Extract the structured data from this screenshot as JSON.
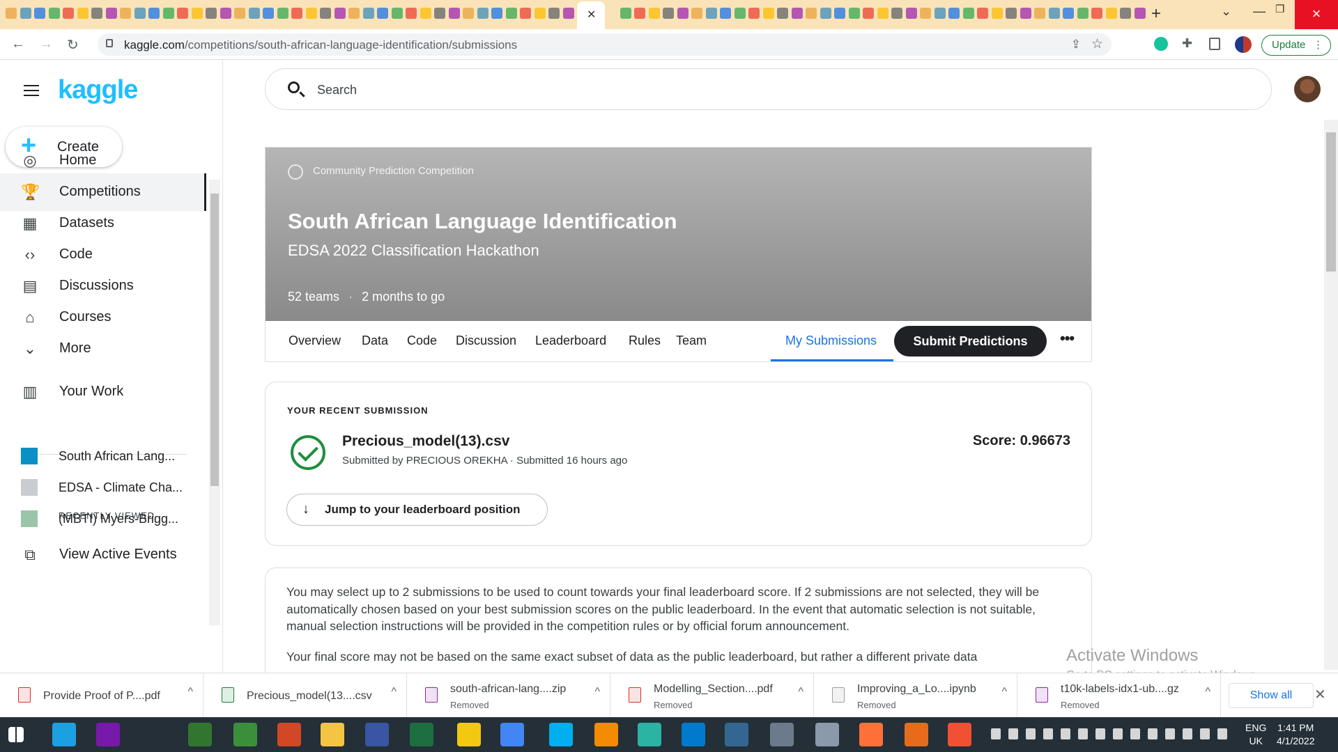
{
  "browser": {
    "url_host": "kaggle.com",
    "url_path": "/competitions/south-african-language-identification/submissions",
    "update_label": "Update",
    "tab_close_glyph": "✕",
    "newtab_glyph": "+"
  },
  "sidebar": {
    "logo": "kaggle",
    "create_label": "Create",
    "items": [
      {
        "label": "Home",
        "icon": "compass-icon",
        "glyph": "◎"
      },
      {
        "label": "Competitions",
        "icon": "trophy-icon",
        "glyph": "🏆"
      },
      {
        "label": "Datasets",
        "icon": "table-icon",
        "glyph": "▦"
      },
      {
        "label": "Code",
        "icon": "code-icon",
        "glyph": "‹›"
      },
      {
        "label": "Discussions",
        "icon": "discussion-icon",
        "glyph": "▤"
      },
      {
        "label": "Courses",
        "icon": "graduation-cap-icon",
        "glyph": "⌂"
      },
      {
        "label": "More",
        "icon": "chevron-down-icon",
        "glyph": "⌄"
      },
      {
        "label": "Your Work",
        "icon": "clipboard-icon",
        "glyph": "▥"
      }
    ],
    "recently_viewed_label": "RECENTLY VIEWED",
    "recent": [
      {
        "label": "South African Lang...",
        "color": "#0a8fc7"
      },
      {
        "label": "EDSA - Climate Cha...",
        "color": "#c9ccd1"
      },
      {
        "label": "(MBTI) Myers-Brigg...",
        "color": "#9bc5a8"
      }
    ],
    "view_events_label": "View Active Events"
  },
  "search": {
    "placeholder": "Search"
  },
  "competition": {
    "type": "Community Prediction Competition",
    "title": "South African Language Identification",
    "subtitle": "EDSA 2022 Classification Hackathon",
    "teams": "52 teams",
    "deadline": "2 months to go",
    "tabs": [
      "Overview",
      "Data",
      "Code",
      "Discussion",
      "Leaderboard",
      "Rules",
      "Team"
    ],
    "my_submissions": "My Submissions",
    "submit_label": "Submit Predictions",
    "more_glyph": "•••"
  },
  "recent_submission": {
    "label": "YOUR RECENT SUBMISSION",
    "filename": "Precious_model(13).csv",
    "byline": "Submitted by PRECIOUS OREKHA · Submitted 16 hours ago",
    "score": "Score: 0.96673",
    "jump_label": "Jump to your leaderboard position",
    "jump_glyph": "↓"
  },
  "info": {
    "p1": "You may select up to 2 submissions to be used to count towards your final leaderboard score. If 2 submissions are not selected, they will be automatically chosen based on your best submission scores on the public leaderboard. In the event that automatic selection is not suitable, manual selection instructions will be provided in the competition rules or by official forum announcement.",
    "p2": "Your final score may not be based on the same exact subset of data as the public leaderboard, but rather a different private data"
  },
  "watermark": {
    "title": "Activate Windows",
    "subtitle": "Go to PC settings to activate Windows."
  },
  "downloads": {
    "items": [
      {
        "name": "Provide Proof of P....pdf",
        "status": "",
        "color": "#d93025"
      },
      {
        "name": "Precious_model(13....csv",
        "status": "",
        "color": "#188038"
      },
      {
        "name": "south-african-lang....zip",
        "status": "Removed",
        "color": "#8e24aa"
      },
      {
        "name": "Modelling_Section....pdf",
        "status": "Removed",
        "color": "#d93025"
      },
      {
        "name": "Improving_a_Lo....ipynb",
        "status": "Removed",
        "color": "#9e9e9e"
      },
      {
        "name": "t10k-labels-idx1-ub....gz",
        "status": "Removed",
        "color": "#8e24aa"
      }
    ],
    "show_all": "Show all",
    "chevron_glyph": "^",
    "close_glyph": "✕"
  },
  "taskbar": {
    "lang": "ENG",
    "region": "UK",
    "time": "1:41 PM",
    "date": "4/1/2022"
  }
}
